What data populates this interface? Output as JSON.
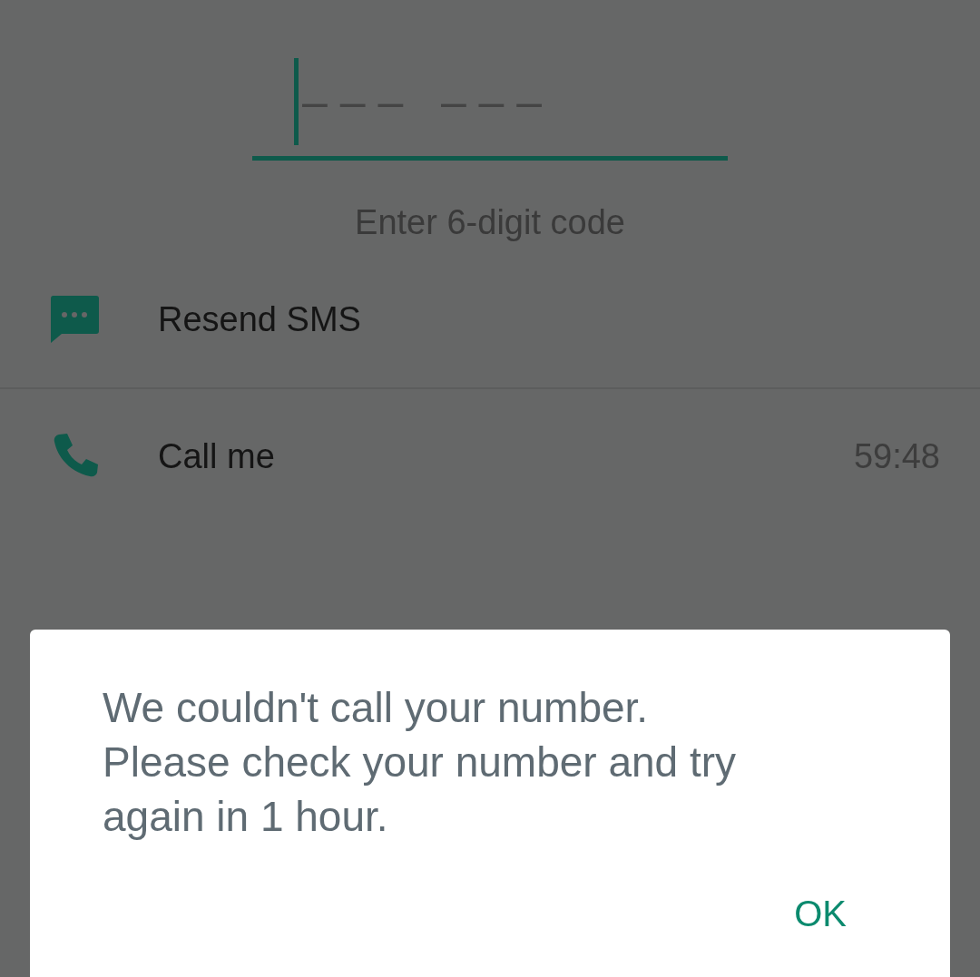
{
  "code_field": {
    "placeholder": "– – –   – – –"
  },
  "hint": "Enter 6-digit code",
  "options": [
    {
      "kind": "sms",
      "label": "Resend SMS"
    },
    {
      "kind": "call",
      "label": "Call me",
      "timer": "59:48"
    }
  ],
  "dialog": {
    "message": "We couldn't call your number. Please check your number and try again in 1 hour.",
    "buttons": [
      "OK"
    ]
  }
}
